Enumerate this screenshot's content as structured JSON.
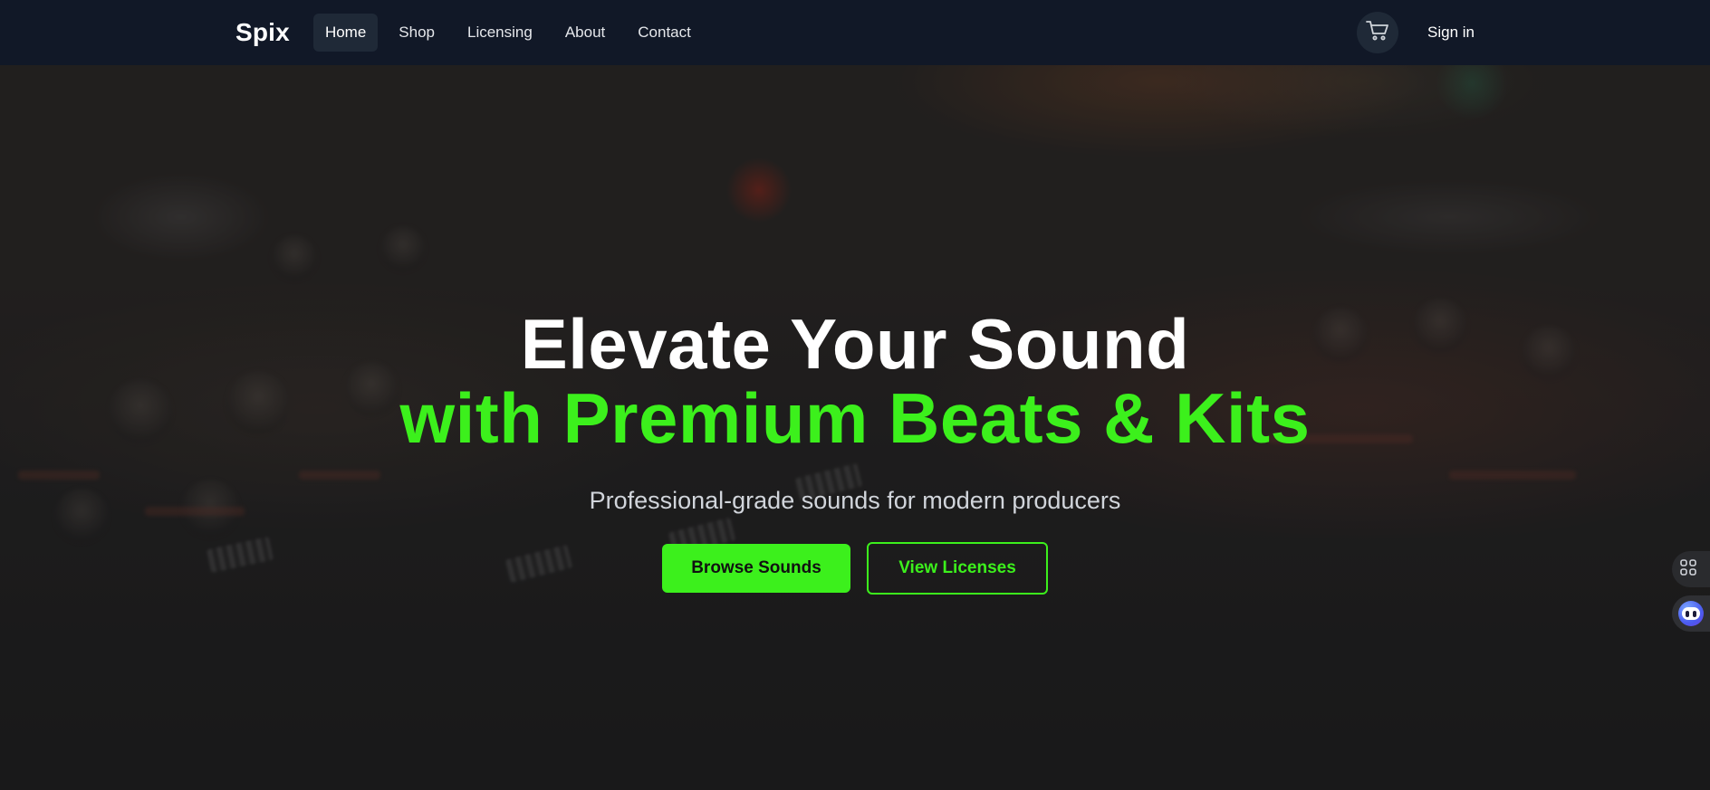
{
  "nav": {
    "logo": "Spix",
    "links": [
      {
        "label": "Home",
        "active": true
      },
      {
        "label": "Shop",
        "active": false
      },
      {
        "label": "Licensing",
        "active": false
      },
      {
        "label": "About",
        "active": false
      },
      {
        "label": "Contact",
        "active": false
      }
    ],
    "cart_icon": "cart-icon",
    "signin_label": "Sign in"
  },
  "hero": {
    "title_line1": "Elevate Your Sound",
    "title_line2": "with Premium Beats & Kits",
    "subtitle": "Professional-grade sounds for modern producers",
    "primary_button": "Browse Sounds",
    "secondary_button": "View Licenses"
  },
  "side_widgets": [
    {
      "icon": "command-icon"
    },
    {
      "icon": "ai-assistant-icon"
    }
  ],
  "colors": {
    "accent": "#3cf01c",
    "nav_bg": "#111827",
    "nav_active_bg": "#1f2937",
    "text_muted": "#d1d5db"
  }
}
